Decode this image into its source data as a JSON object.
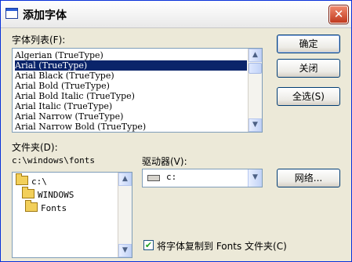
{
  "window": {
    "title": "添加字体",
    "close_glyph": "✕"
  },
  "font_list": {
    "label": "字体列表(F):",
    "items": [
      "Algerian (TrueType)",
      "Arial (TrueType)",
      "Arial Black (TrueType)",
      "Arial Bold (TrueType)",
      "Arial Bold Italic (TrueType)",
      "Arial Italic (TrueType)",
      "Arial Narrow (TrueType)",
      "Arial Narrow Bold (TrueType)"
    ],
    "selected_index": 1
  },
  "folder": {
    "label": "文件夹(D):",
    "path": "c:\\windows\\fonts",
    "tree": [
      "c:\\",
      "WINDOWS",
      "Fonts"
    ]
  },
  "drives": {
    "label": "驱动器(V):",
    "value": "c:"
  },
  "buttons": {
    "ok": "确定",
    "close": "关闭",
    "select_all": "全选(S)",
    "network": "网络..."
  },
  "copy_option": {
    "label": "将字体复制到 Fonts 文件夹(C)",
    "checked": true
  },
  "icons": {
    "window": "window-icon",
    "close": "close-icon",
    "folder": "folder-icon",
    "drive": "drive-icon",
    "scroll_up": "scroll-up-icon",
    "scroll_down": "scroll-down-icon",
    "dropdown": "chevron-down-icon",
    "check": "checkmark-icon"
  },
  "colors": {
    "selection": "#0a246a",
    "title_border": "#0831d9",
    "close_button": "#c0391e"
  }
}
